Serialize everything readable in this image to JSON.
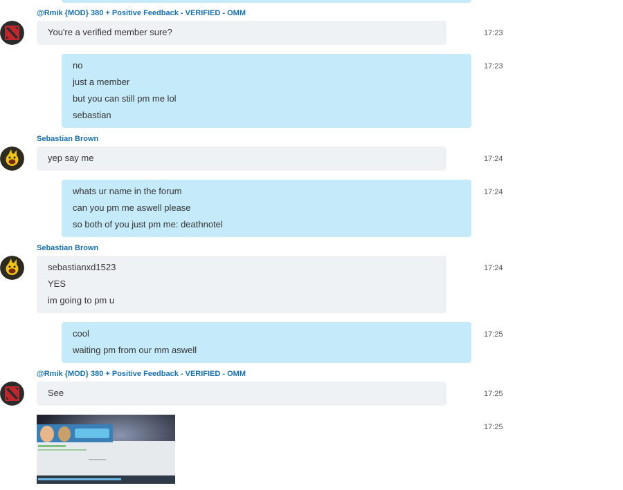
{
  "messages": [
    {
      "sender": "@Rmik {MOD} 380 + Positive Feedback - VERIFIED - OMM",
      "lines": [
        "You're a verified member sure?"
      ],
      "time": "17:23"
    },
    {
      "lines": [
        "no",
        "just a member",
        "but you can still pm me lol",
        "sebastian"
      ],
      "time": "17:23"
    },
    {
      "sender": "Sebastian Brown",
      "lines": [
        "yep say me"
      ],
      "time": "17:24"
    },
    {
      "lines": [
        "whats ur name in the forum",
        "can you pm me aswell please",
        "so both of you just pm me: deathnotel"
      ],
      "time": "17:24"
    },
    {
      "sender": "Sebastian Brown",
      "lines": [
        "sebastianxd1523",
        "YES",
        "im going to pm u"
      ],
      "time": "17:24"
    },
    {
      "lines": [
        "cool",
        "waiting pm from our mm aswell"
      ],
      "time": "17:25"
    },
    {
      "sender": "@Rmik {MOD} 380 + Positive Feedback - VERIFIED - OMM",
      "lines": [
        "See"
      ],
      "time": "17:25"
    },
    {
      "image_icon": "photo-thumbnail",
      "time": "17:25"
    }
  ],
  "colors": {
    "incoming_bubble": "#eff2f5",
    "outgoing_bubble": "#c5eafa",
    "sender_name": "#1a6fa6"
  }
}
